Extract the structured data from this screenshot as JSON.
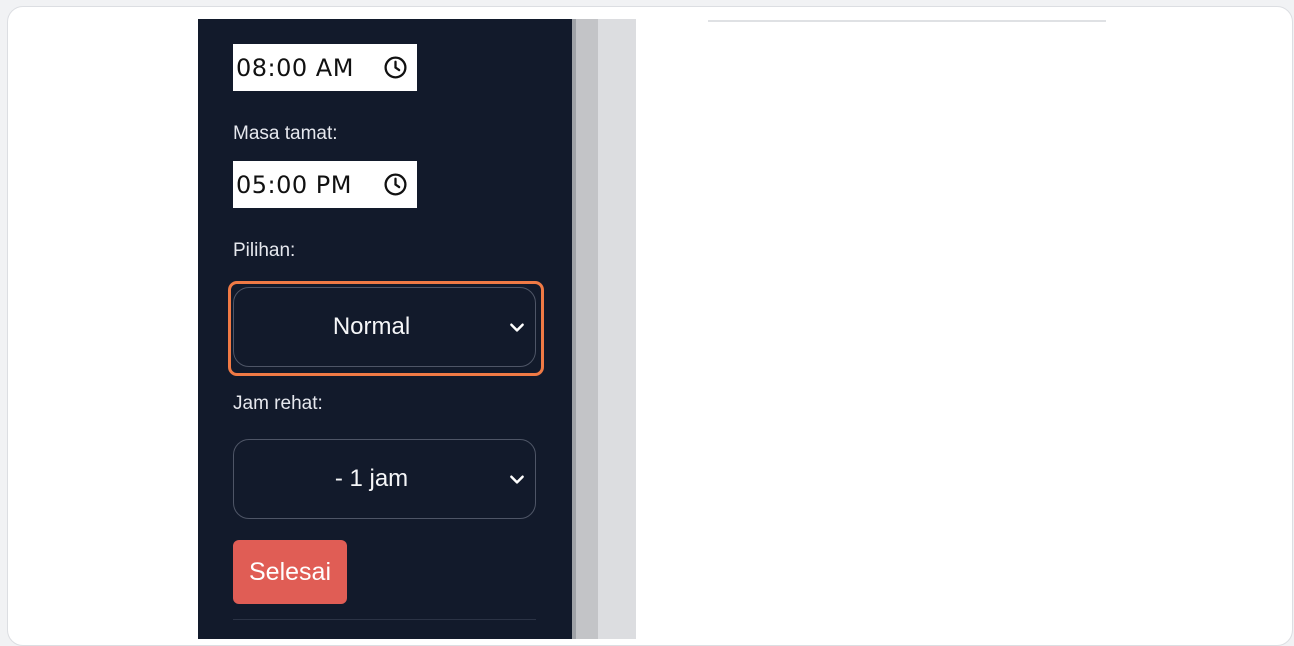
{
  "form": {
    "start_time": {
      "value": "08:00 AM"
    },
    "end_time": {
      "label": "Masa tamat:",
      "value": "05:00 PM"
    },
    "option": {
      "label": "Pilihan:",
      "selected": "Normal"
    },
    "break": {
      "label": "Jam rehat:",
      "selected": "- 1 jam"
    },
    "submit_label": "Selesai"
  },
  "icons": {
    "clock": "clock-icon",
    "chevron": "chevron-down-icon"
  },
  "colors": {
    "panel_bg": "#121a2b",
    "highlight": "#f07a45",
    "submit_bg": "#e05d55"
  }
}
